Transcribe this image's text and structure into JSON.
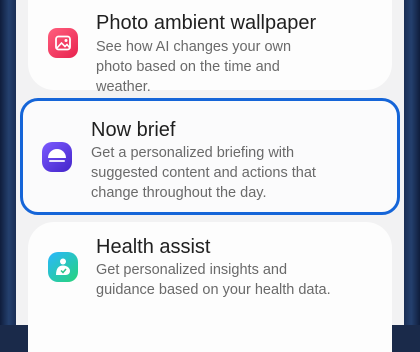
{
  "settings": {
    "items": [
      {
        "title": "Photo ambient wallpaper",
        "description": "See how AI changes your own photo based on the time and weather.",
        "icon": "photo-icon",
        "selected": false
      },
      {
        "title": "Now brief",
        "description": "Get a personalized briefing with suggested content and actions that change throughout the day.",
        "icon": "now-brief-icon",
        "selected": true
      },
      {
        "title": "Health assist",
        "description": "Get personalized insights and guidance based on your health data.",
        "icon": "health-icon",
        "selected": false
      }
    ]
  },
  "colors": {
    "selection_border": "#1565d8",
    "card_background": "#fdfdfd",
    "screen_background": "#f2f2f3"
  }
}
